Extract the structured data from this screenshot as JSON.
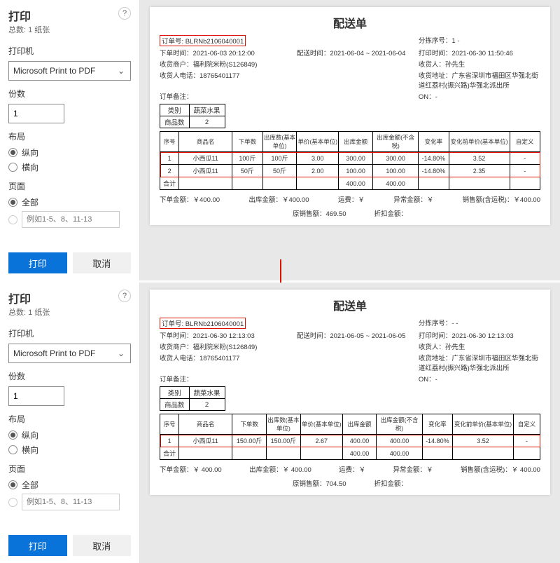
{
  "sidebar": {
    "title": "打印",
    "subtitle": "总数: 1 纸张",
    "printer_label": "打印机",
    "printer_value": "Microsoft Print to PDF",
    "copies_label": "份数",
    "copies_value": "1",
    "layout_label": "布局",
    "layout_portrait": "纵向",
    "layout_landscape": "横向",
    "pages_label": "页面",
    "pages_all": "全部",
    "pages_custom_placeholder": "例如1-5、8、11-13",
    "print_btn": "打印",
    "cancel_btn": "取消"
  },
  "doc1": {
    "title": "配送单",
    "order_no_label": "订单号:",
    "order_no": "BLRNb2106040001",
    "sort_label": "分拣序号：",
    "sort_val": "1 -",
    "place_time_label": "下单时间：",
    "place_time": "2021-06-03 20:12:00",
    "deliver_time_label": "配送时间：",
    "deliver_time": "2021-06-04 ~ 2021-06-04",
    "print_time_label": "打印时间：",
    "print_time": "2021-06-30 11:50:46",
    "merchant_label": "收货商户：",
    "merchant": "福利院米粉(S126849)",
    "receiver_label": "收货人：",
    "receiver": "孙先生",
    "phone_label": "收货人电话：",
    "phone": "18765401177",
    "addr_label": "收货地址：",
    "addr": "广东省深圳市福田区华强北街道红荔村(振兴路)华强北派出所",
    "remark_label": "订单备注：",
    "on_label": "ON：-",
    "cat_label": "类别",
    "cat_val": "蔬菜水果",
    "count_label": "商品数",
    "count_val": "2",
    "headers": [
      "序号",
      "商品名",
      "下单数",
      "出库数(基本单位)",
      "单价(基本单位)",
      "出库金额",
      "出库金额(不含税)",
      "变化率",
      "变化前单价(基本单位)",
      "自定义"
    ],
    "rows": [
      [
        "1",
        "小西瓜11",
        "100斤",
        "100斤",
        "3.00",
        "300.00",
        "300.00",
        "-14.80%",
        "3.52",
        "-"
      ],
      [
        "2",
        "小西瓜11",
        "50斤",
        "50斤",
        "2.00",
        "100.00",
        "100.00",
        "-14.80%",
        "2.35",
        "-"
      ]
    ],
    "total_label": "合计",
    "total_out": "400.00",
    "total_out_notax": "400.00",
    "sum": {
      "order_amt_label": "下单金额：",
      "order_amt": "￥400.00",
      "out_amt_label": "出库金额：",
      "out_amt": "￥400.00",
      "ship_label": "运费：",
      "ship": "￥",
      "abn_label": "异常金额：",
      "abn": "￥",
      "sale_label": "销售额(含运税)：",
      "sale": "￥400.00",
      "orig_label": "原销售额：",
      "orig": "469.50",
      "disc_label": "折扣金额："
    }
  },
  "doc2": {
    "title": "配送单",
    "order_no_label": "订单号:",
    "order_no": "BLRNb2106040001",
    "sort_label": "分拣序号：",
    "sort_val": "- -",
    "place_time_label": "下单时间：",
    "place_time": "2021-06-30 12:13:03",
    "deliver_time_label": "配送时间：",
    "deliver_time": "2021-06-05 ~ 2021-06-05",
    "print_time_label": "打印时间：",
    "print_time": "2021-06-30 12:13:03",
    "merchant_label": "收货商户：",
    "merchant": "福利院米粉(S126849)",
    "receiver_label": "收货人：",
    "receiver": "孙先生",
    "phone_label": "收货人电话：",
    "phone": "18765401177",
    "addr_label": "收货地址：",
    "addr": "广东省深圳市福田区华强北街道红荔村(振兴路)华强北派出所",
    "remark_label": "订单备注：",
    "on_label": "ON：-",
    "cat_label": "类别",
    "cat_val": "蔬菜水果",
    "count_label": "商品数",
    "count_val": "2",
    "headers": [
      "序号",
      "商品名",
      "下单数",
      "出库数(基本单位)",
      "单价(基本单位)",
      "出库金额",
      "出库金额(不含税)",
      "变化率",
      "变化前单价(基本单位)",
      "自定义"
    ],
    "rows": [
      [
        "1",
        "小西瓜11",
        "150.00斤",
        "150.00斤",
        "2.67",
        "400.00",
        "400.00",
        "-14.80%",
        "3.52",
        "-"
      ]
    ],
    "total_label": "合计",
    "total_out": "400.00",
    "total_out_notax": "400.00",
    "sum": {
      "order_amt_label": "下单金额：",
      "order_amt": "￥ 400.00",
      "out_amt_label": "出库金额：",
      "out_amt": "￥ 400.00",
      "ship_label": "运费：",
      "ship": "￥",
      "abn_label": "异常金额：",
      "abn": "￥",
      "sale_label": "销售额(含运税)：",
      "sale": "￥ 400.00",
      "orig_label": "原销售额：",
      "orig": "704.50",
      "disc_label": "折扣金额："
    }
  }
}
